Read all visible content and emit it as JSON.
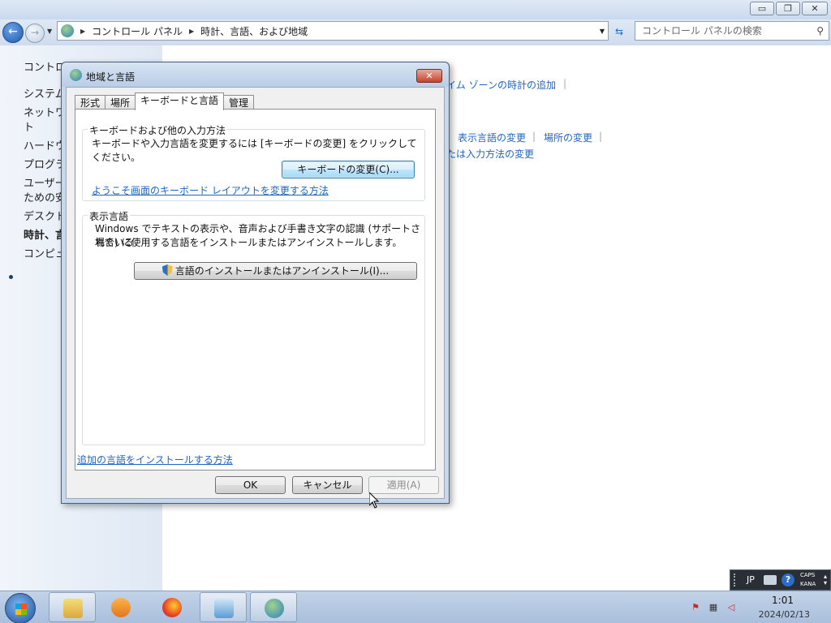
{
  "window": {
    "caption": {
      "minimize": "▭",
      "maximize": "❐",
      "close": "✕"
    }
  },
  "navbar": {
    "breadcrumb": [
      "コントロール パネル",
      "時計、言語、および地域"
    ],
    "search_placeholder": "コントロール パネルの検索"
  },
  "sidebar": {
    "items": [
      {
        "label": "コントロ"
      },
      {
        "label": "システム"
      },
      {
        "label": "ネットワ"
      },
      {
        "label": "ト"
      },
      {
        "label": "ハードウ"
      },
      {
        "label": "プログラ"
      },
      {
        "label": "ユーザー"
      },
      {
        "label": "ための安"
      },
      {
        "label": "デスクト"
      },
      {
        "label": "時計、言"
      },
      {
        "label": "コンピュ"
      }
    ]
  },
  "content_links": {
    "timezone": "イム ゾーンの時計の追加",
    "display_language": "表示言語の変更",
    "location": "場所の変更",
    "input_method": "たは入力方法の変更"
  },
  "dialog": {
    "title": "地域と言語",
    "close": "✕",
    "tabs": [
      {
        "label": "形式"
      },
      {
        "label": "場所"
      },
      {
        "label": "キーボードと言語"
      },
      {
        "label": "管理"
      }
    ],
    "keyboard_group": {
      "label": "キーボードおよび他の入力方法",
      "description": "キーボードや入力言語を変更するには [キーボードの変更] をクリックしてください。",
      "button": "キーボードの変更(C)...",
      "link": "ようこそ画面のキーボード レイアウトを変更する方法"
    },
    "display_group": {
      "label": "表示言語",
      "description_line1": "Windows でテキストの表示や、音声および手書き文字の認識 (サポートされている",
      "description_line2": "場合) に使用する言語をインストールまたはアンインストールします。",
      "button": "言語のインストールまたはアンインストール(I)..."
    },
    "install_link": "追加の言語をインストールする方法",
    "ok": "OK",
    "cancel": "キャンセル",
    "apply": "適用(A)"
  },
  "taskbar": {
    "time": "1:01",
    "date": "2024/02/13"
  },
  "langbar": {
    "language": "JP",
    "caps": "CAPS",
    "kana": "KANA"
  }
}
